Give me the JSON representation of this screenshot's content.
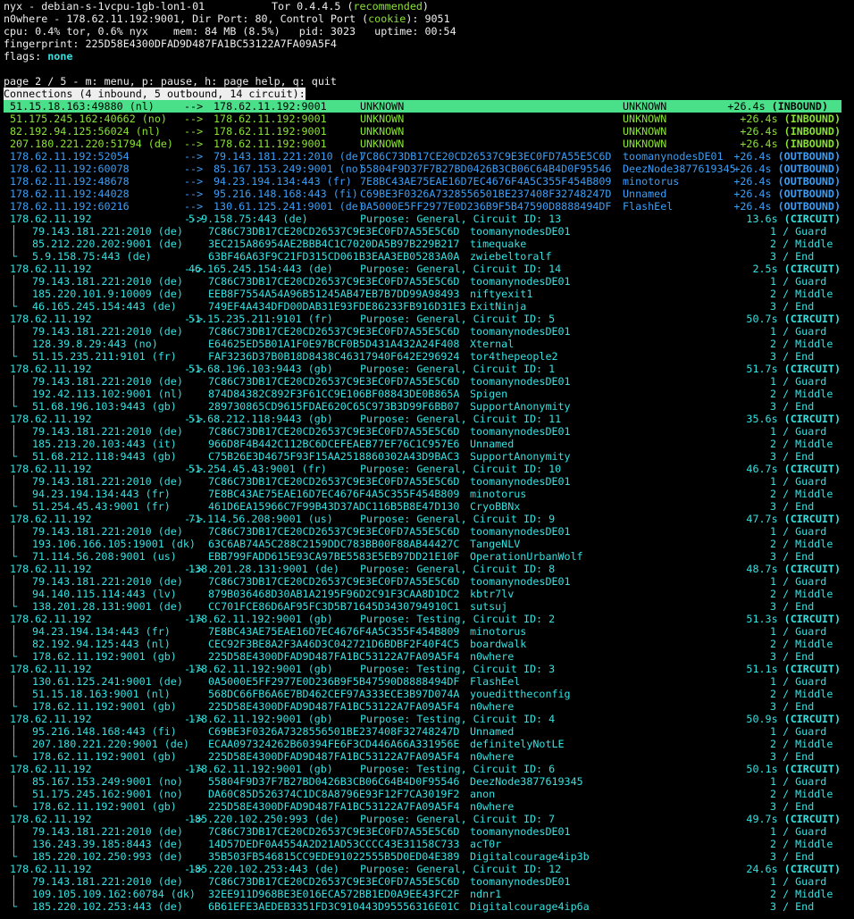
{
  "status": {
    "line1_left": "nyx - debian-s-1vcpu-1gb-lon1-01",
    "version": "Tor 0.4.4.5 (",
    "version_recommended": "recommended",
    "version_close": ")",
    "line2_start": "n0where - 178.62.11.192:9001, Dir Port: 80, Control Port (",
    "line2_cookie": "cookie",
    "line2_end": "): 9051",
    "line3": "cpu: 0.4% tor, 0.6% nyx    mem: 84 MB (8.5%)   pid: 3023   uptime: 00:54",
    "line4": "fingerprint: 225D58E4300DFAD9D487FA1BC53122A7FA09A5F4",
    "flags_label": "flags: ",
    "flags_value": "none"
  },
  "page_info": "page 2 / 5 - m: menu, p: pause, h: page help, q: quit",
  "section_header": "Connections (4 inbound, 5 outbound, 14 circuit):",
  "arrow": "-->",
  "connections": [
    {
      "src": "51.15.18.163:49880 (nl)",
      "dst": "178.62.11.192:9001",
      "fp": "UNKNOWN",
      "nick": "UNKNOWN",
      "time": "+26.4s",
      "type": "(INBOUND)",
      "color": "#8ae234",
      "selected": true
    },
    {
      "src": "51.175.245.162:40662 (no)",
      "dst": "178.62.11.192:9001",
      "fp": "UNKNOWN",
      "nick": "UNKNOWN",
      "time": "+26.4s",
      "type": "(INBOUND)",
      "color": "#8ae234"
    },
    {
      "src": "82.192.94.125:56024 (nl)",
      "dst": "178.62.11.192:9001",
      "fp": "UNKNOWN",
      "nick": "UNKNOWN",
      "time": "+26.4s",
      "type": "(INBOUND)",
      "color": "#8ae234"
    },
    {
      "src": "207.180.221.220:51794 (de)",
      "dst": "178.62.11.192:9001",
      "fp": "UNKNOWN",
      "nick": "UNKNOWN",
      "time": "+26.4s",
      "type": "(INBOUND)",
      "color": "#8ae234"
    },
    {
      "src": "178.62.11.192:52054",
      "dst": "79.143.181.221:2010 (de)",
      "fp": "7C86C73DB17CE20CD26537C9E3EC0FD7A55E5C6D",
      "nick": "toomanynodesDE01",
      "time": "+26.4s",
      "type": "(OUTBOUND)",
      "color": "#3b9ef6"
    },
    {
      "src": "178.62.11.192:60078",
      "dst": "85.167.153.249:9001 (no)",
      "fp": "55804F9D37F7B27BD0426B3CB06C64B4D0F95546",
      "nick": "DeezNode3877619345",
      "time": "+26.4s",
      "type": "(OUTBOUND)",
      "color": "#3b9ef6"
    },
    {
      "src": "178.62.11.192:48678",
      "dst": "94.23.194.134:443 (fr)",
      "fp": "7E8BC43AE75EAE16D7EC4676F4A5C355F454B809",
      "nick": "minotorus",
      "time": "+26.4s",
      "type": "(OUTBOUND)",
      "color": "#3b9ef6"
    },
    {
      "src": "178.62.11.192:44028",
      "dst": "95.216.148.168:443 (fi)",
      "fp": "C69BE3F0326A7328556501BE237408F32748247D",
      "nick": "Unnamed",
      "time": "+26.4s",
      "type": "(OUTBOUND)",
      "color": "#3b9ef6"
    },
    {
      "src": "178.62.11.192:60216",
      "dst": "130.61.125.241:9001 (de)",
      "fp": "0A5000E5FF2977E0D236B9F5B47590D8888494DF",
      "nick": "FlashEel",
      "time": "+26.4s",
      "type": "(OUTBOUND)",
      "color": "#3b9ef6"
    }
  ],
  "circuits": [
    {
      "src": "178.62.11.192",
      "dst": "5.9.158.75:443 (de)",
      "purpose": "Purpose: General, Circuit ID: 13",
      "time": "13.6s",
      "type": "(CIRCUIT)",
      "hops": [
        {
          "addr": "79.143.181.221:2010 (de)",
          "fp": "7C86C73DB17CE20CD26537C9E3EC0FD7A55E5C6D",
          "nick": "toomanynodesDE01",
          "role": "1 / Guard"
        },
        {
          "addr": "85.212.220.202:9001 (de)",
          "fp": "3EC215A86954AE2BBB4C1C7020DA5B97B229B217",
          "nick": "timequake",
          "role": "2 / Middle"
        },
        {
          "addr": "5.9.158.75:443 (de)",
          "fp": "63BF46A63F9C21FD315CD061B3EAA3EB05283A0A",
          "nick": "zwiebeltoralf",
          "role": "3 / End"
        }
      ]
    },
    {
      "src": "178.62.11.192",
      "dst": "46.165.245.154:443 (de)",
      "purpose": "Purpose: General, Circuit ID: 14",
      "time": "2.5s",
      "type": "(CIRCUIT)",
      "hops": [
        {
          "addr": "79.143.181.221:2010 (de)",
          "fp": "7C86C73DB17CE20CD26537C9E3EC0FD7A55E5C6D",
          "nick": "toomanynodesDE01",
          "role": "1 / Guard"
        },
        {
          "addr": "185.220.101.9:10009 (de)",
          "fp": "EEB8F7554A54A96B51245AB47EB7B7DD99A98493",
          "nick": "niftyexit1",
          "role": "2 / Middle"
        },
        {
          "addr": "46.165.245.154:443 (de)",
          "fp": "749EF4A434DFD00DAB31E93FDE86233FB916D31E3",
          "nick": "ExitNinja",
          "role": "3 / End"
        }
      ]
    },
    {
      "src": "178.62.11.192",
      "dst": "51.15.235.211:9101 (fr)",
      "purpose": "Purpose: General, Circuit ID: 5",
      "time": "50.7s",
      "type": "(CIRCUIT)",
      "hops": [
        {
          "addr": "79.143.181.221:2010 (de)",
          "fp": "7C86C73DB17CE20CD26537C9E3EC0FD7A55E5C6D",
          "nick": "toomanynodesDE01",
          "role": "1 / Guard"
        },
        {
          "addr": "128.39.8.29:443 (no)",
          "fp": "E64625ED5B01A1F0E97BCF0B5D431A432A24F408",
          "nick": "Xternal",
          "role": "2 / Middle"
        },
        {
          "addr": "51.15.235.211:9101 (fr)",
          "fp": "FAF3236D37B0B18D8438C46317940F642E296924",
          "nick": "tor4thepeople2",
          "role": "3 / End"
        }
      ]
    },
    {
      "src": "178.62.11.192",
      "dst": "51.68.196.103:9443 (gb)",
      "purpose": "Purpose: General, Circuit ID: 1",
      "time": "51.7s",
      "type": "(CIRCUIT)",
      "hops": [
        {
          "addr": "79.143.181.221:2010 (de)",
          "fp": "7C86C73DB17CE20CD26537C9E3EC0FD7A55E5C6D",
          "nick": "toomanynodesDE01",
          "role": "1 / Guard"
        },
        {
          "addr": "192.42.113.102:9001 (nl)",
          "fp": "874D84382C892F3F61CC9E106BF08843DE0B865A",
          "nick": "Spigen",
          "role": "2 / Middle"
        },
        {
          "addr": "51.68.196.103:9443 (gb)",
          "fp": "289730865CD9615FDAE620C65C973B3D99F6BB07",
          "nick": "SupportAnonymity",
          "role": "3 / End"
        }
      ]
    },
    {
      "src": "178.62.11.192",
      "dst": "51.68.212.118:9443 (gb)",
      "purpose": "Purpose: General, Circuit ID: 11",
      "time": "35.6s",
      "type": "(CIRCUIT)",
      "hops": [
        {
          "addr": "79.143.181.221:2010 (de)",
          "fp": "7C86C73DB17CE20CD26537C9E3EC0FD7A55E5C6D",
          "nick": "toomanynodesDE01",
          "role": "1 / Guard"
        },
        {
          "addr": "185.213.20.103:443 (it)",
          "fp": "966D8F4B442C112BC6DCEFEAEB77EF76C1C957E6",
          "nick": "Unnamed",
          "role": "2 / Middle"
        },
        {
          "addr": "51.68.212.118:9443 (gb)",
          "fp": "C75B26E3D4675F93F15AA2518860302A43D9BAC3",
          "nick": "SupportAnonymity",
          "role": "3 / End"
        }
      ]
    },
    {
      "src": "178.62.11.192",
      "dst": "51.254.45.43:9001 (fr)",
      "purpose": "Purpose: General, Circuit ID: 10",
      "time": "46.7s",
      "type": "(CIRCUIT)",
      "hops": [
        {
          "addr": "79.143.181.221:2010 (de)",
          "fp": "7C86C73DB17CE20CD26537C9E3EC0FD7A55E5C6D",
          "nick": "toomanynodesDE01",
          "role": "1 / Guard"
        },
        {
          "addr": "94.23.194.134:443 (fr)",
          "fp": "7E8BC43AE75EAE16D7EC4676F4A5C355F454B809",
          "nick": "minotorus",
          "role": "2 / Middle"
        },
        {
          "addr": "51.254.45.43:9001 (fr)",
          "fp": "461D6EA15966C7F99B43D37ADC116B5B8E47D130",
          "nick": "CryoBBNx",
          "role": "3 / End"
        }
      ]
    },
    {
      "src": "178.62.11.192",
      "dst": "71.114.56.208:9001 (us)",
      "purpose": "Purpose: General, Circuit ID: 9",
      "time": "47.7s",
      "type": "(CIRCUIT)",
      "hops": [
        {
          "addr": "79.143.181.221:2010 (de)",
          "fp": "7C86C73DB17CE20CD26537C9E3EC0FD7A55E5C6D",
          "nick": "toomanynodesDE01",
          "role": "1 / Guard"
        },
        {
          "addr": "193.106.166.105:19001 (dk)",
          "fp": "63C6AB74A5C288C2159DDC783BB00F88AB44427C",
          "nick": "TangeNLV",
          "role": "2 / Middle"
        },
        {
          "addr": "71.114.56.208:9001 (us)",
          "fp": "EBB799FADD615E93CA97BE5583E5EB97DD21E10F",
          "nick": "OperationUrbanWolf",
          "role": "3 / End"
        }
      ]
    },
    {
      "src": "178.62.11.192",
      "dst": "138.201.28.131:9001 (de)",
      "purpose": "Purpose: General, Circuit ID: 8",
      "time": "48.7s",
      "type": "(CIRCUIT)",
      "hops": [
        {
          "addr": "79.143.181.221:2010 (de)",
          "fp": "7C86C73DB17CE20CD26537C9E3EC0FD7A55E5C6D",
          "nick": "toomanynodesDE01",
          "role": "1 / Guard"
        },
        {
          "addr": "94.140.115.114:443 (lv)",
          "fp": "879B036468D30AB1A2195F96D2C91F3CAA8D1DC2",
          "nick": "kbtr7lv",
          "role": "2 / Middle"
        },
        {
          "addr": "138.201.28.131:9001 (de)",
          "fp": "CC701FCE86D6AF95FC3D5B71645D3430794910C1",
          "nick": "sutsuj",
          "role": "3 / End"
        }
      ]
    },
    {
      "src": "178.62.11.192",
      "dst": "178.62.11.192:9001 (gb)",
      "purpose": "Purpose: Testing, Circuit ID: 2",
      "time": "51.3s",
      "type": "(CIRCUIT)",
      "hops": [
        {
          "addr": "94.23.194.134:443 (fr)",
          "fp": "7E8BC43AE75EAE16D7EC4676F4A5C355F454B809",
          "nick": "minotorus",
          "role": "1 / Guard"
        },
        {
          "addr": "82.192.94.125:443 (nl)",
          "fp": "CEC92F3BE8A2F3A46D3C042721D6BDBF2F40F4C5",
          "nick": "boardwalk",
          "role": "2 / Middle"
        },
        {
          "addr": "178.62.11.192:9001 (gb)",
          "fp": "225D58E4300DFAD9D487FA1BC53122A7FA09A5F4",
          "nick": "n0where",
          "role": "3 / End"
        }
      ]
    },
    {
      "src": "178.62.11.192",
      "dst": "178.62.11.192:9001 (gb)",
      "purpose": "Purpose: Testing, Circuit ID: 3",
      "time": "51.1s",
      "type": "(CIRCUIT)",
      "hops": [
        {
          "addr": "130.61.125.241:9001 (de)",
          "fp": "0A5000E5FF2977E0D236B9F5B47590D8888494DF",
          "nick": "FlashEel",
          "role": "1 / Guard"
        },
        {
          "addr": "51.15.18.163:9001 (nl)",
          "fp": "568DC66FB6A6E7BD462CEF97A333ECE3B97D074A",
          "nick": "youedittheconfig",
          "role": "2 / Middle"
        },
        {
          "addr": "178.62.11.192:9001 (gb)",
          "fp": "225D58E4300DFAD9D487FA1BC53122A7FA09A5F4",
          "nick": "n0where",
          "role": "3 / End"
        }
      ]
    },
    {
      "src": "178.62.11.192",
      "dst": "178.62.11.192:9001 (gb)",
      "purpose": "Purpose: Testing, Circuit ID: 4",
      "time": "50.9s",
      "type": "(CIRCUIT)",
      "hops": [
        {
          "addr": "95.216.148.168:443 (fi)",
          "fp": "C69BE3F0326A7328556501BE237408F32748247D",
          "nick": "Unnamed",
          "role": "1 / Guard"
        },
        {
          "addr": "207.180.221.220:9001 (de)",
          "fp": "ECAA097324262B60394FE6F3CD446A66A331956E",
          "nick": "definitelyNotLE",
          "role": "2 / Middle"
        },
        {
          "addr": "178.62.11.192:9001 (gb)",
          "fp": "225D58E4300DFAD9D487FA1BC53122A7FA09A5F4",
          "nick": "n0where",
          "role": "3 / End"
        }
      ]
    },
    {
      "src": "178.62.11.192",
      "dst": "178.62.11.192:9001 (gb)",
      "purpose": "Purpose: Testing, Circuit ID: 6",
      "time": "50.1s",
      "type": "(CIRCUIT)",
      "hops": [
        {
          "addr": "85.167.153.249:9001 (no)",
          "fp": "55804F9D37F7B27BD0426B3CB06C64B4D0F95546",
          "nick": "DeezNode3877619345",
          "role": "1 / Guard"
        },
        {
          "addr": "51.175.245.162:9001 (no)",
          "fp": "DA60C85D526374C1DC8A8796E93F12F7CA3019F2",
          "nick": "anon",
          "role": "2 / Middle"
        },
        {
          "addr": "178.62.11.192:9001 (gb)",
          "fp": "225D58E4300DFAD9D487FA1BC53122A7FA09A5F4",
          "nick": "n0where",
          "role": "3 / End"
        }
      ]
    },
    {
      "src": "178.62.11.192",
      "dst": "185.220.102.250:993 (de)",
      "purpose": "Purpose: General, Circuit ID: 7",
      "time": "49.7s",
      "type": "(CIRCUIT)",
      "hops": [
        {
          "addr": "79.143.181.221:2010 (de)",
          "fp": "7C86C73DB17CE20CD26537C9E3EC0FD7A55E5C6D",
          "nick": "toomanynodesDE01",
          "role": "1 / Guard"
        },
        {
          "addr": "136.243.39.185:8443 (de)",
          "fp": "14D57DEDF0A4554A2D21AD53CCCC43E31158C733",
          "nick": "acT0r",
          "role": "2 / Middle"
        },
        {
          "addr": "185.220.102.250:993 (de)",
          "fp": "35B503FB546815CC9EDE91022555B5D0ED04E389",
          "nick": "Digitalcourage4ip3b",
          "role": "3 / End"
        }
      ]
    },
    {
      "src": "178.62.11.192",
      "dst": "185.220.102.253:443 (de)",
      "purpose": "Purpose: General, Circuit ID: 12",
      "time": "24.6s",
      "type": "(CIRCUIT)",
      "hops": [
        {
          "addr": "79.143.181.221:2010 (de)",
          "fp": "7C86C73DB17CE20CD26537C9E3EC0FD7A55E5C6D",
          "nick": "toomanynodesDE01",
          "role": "1 / Guard"
        },
        {
          "addr": "109.105.109.162:60784 (dk)",
          "fp": "32EE911D968BE3E016ECA572BB1ED0A9EE43FC2F",
          "nick": "ndnr1",
          "role": "2 / Middle"
        },
        {
          "addr": "185.220.102.253:443 (de)",
          "fp": "6B61EFE3AEDEB3351FD3C910443D95556316E01C",
          "nick": "Digitalcourage4ip6a",
          "role": "3 / End"
        }
      ]
    }
  ],
  "colors": {
    "inbound": "#8ae234",
    "outbound": "#3b9ef6",
    "circuit": "#34e2e2",
    "selected_bg": "#4ae08a",
    "text": "#eeeeee",
    "background": "#000000"
  }
}
